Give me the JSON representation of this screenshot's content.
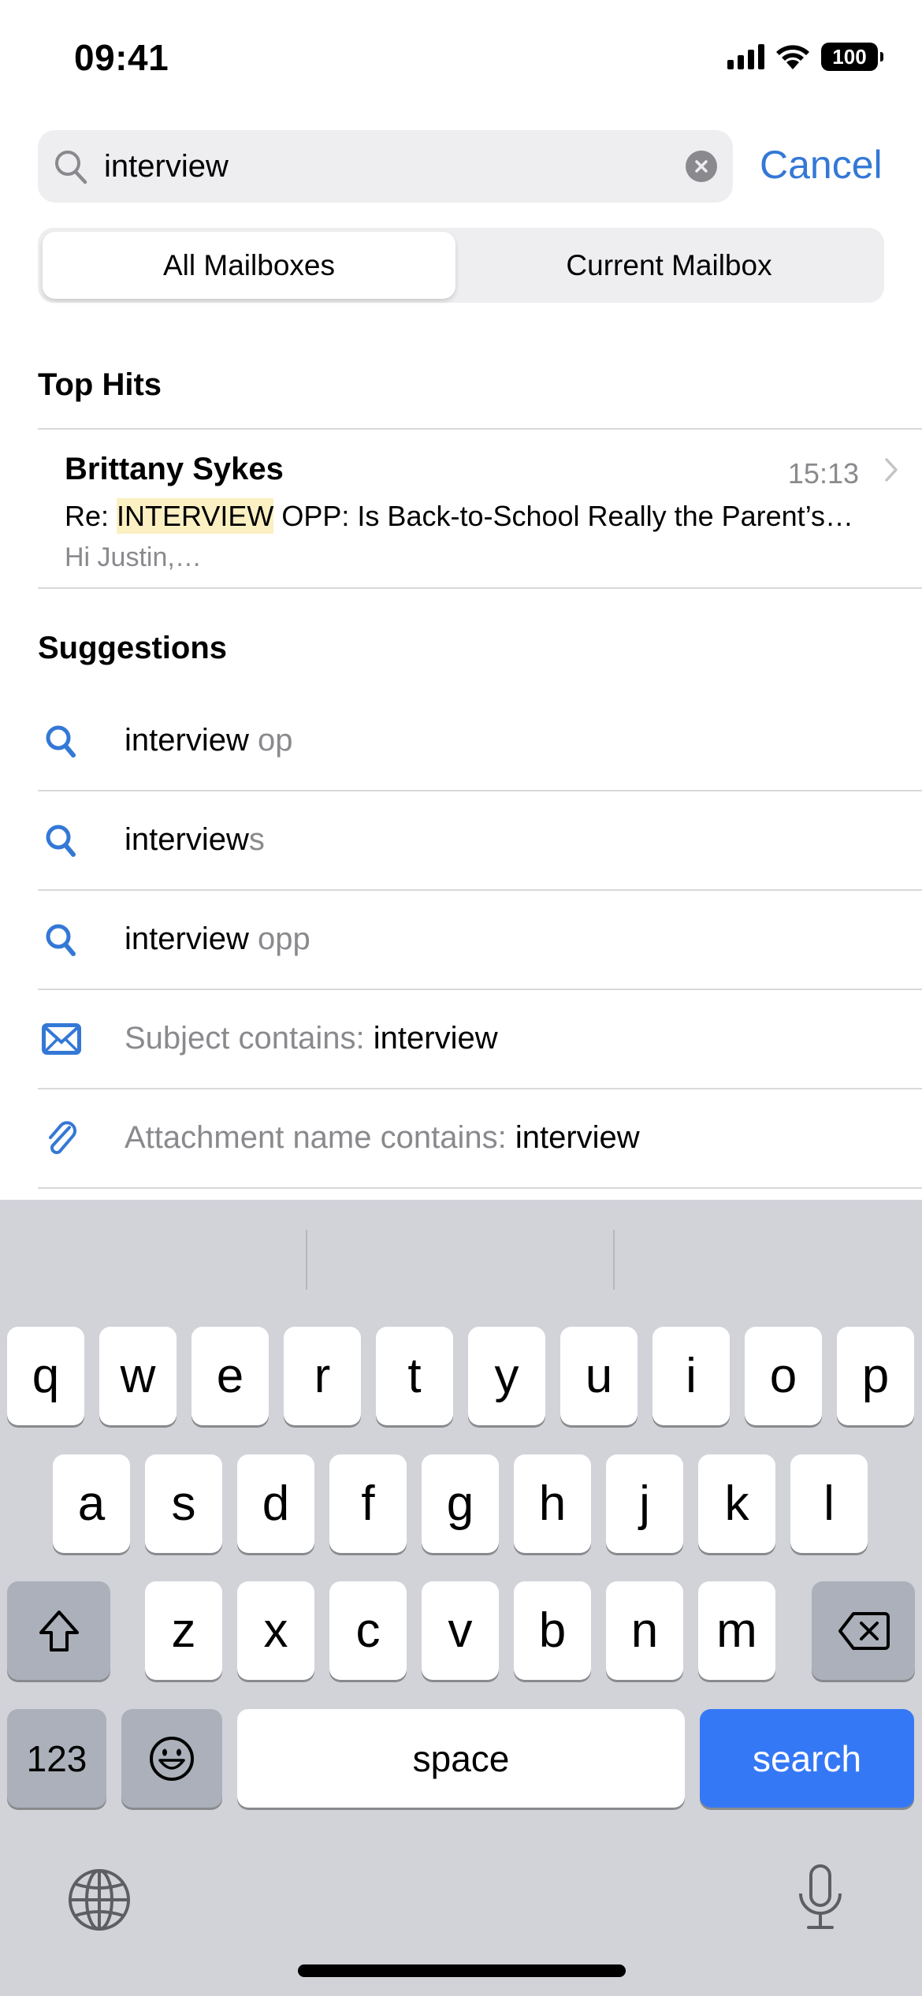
{
  "status_bar": {
    "time": "09:41",
    "battery": "100",
    "icons": [
      "cellular-signal-icon",
      "wifi-icon",
      "battery-icon"
    ]
  },
  "search": {
    "value": "interview",
    "placeholder": "Search",
    "cancel_label": "Cancel",
    "icons": [
      "search-icon",
      "clear-icon"
    ]
  },
  "scope": {
    "options": [
      "All Mailboxes",
      "Current Mailbox"
    ],
    "selected": "All Mailboxes"
  },
  "top_hits": {
    "title": "Top Hits",
    "items": [
      {
        "sender": "Brittany Sykes",
        "time": "15:13",
        "subject_prefix": "Re: ",
        "subject_highlight": "INTERVIEW",
        "subject_rest": " OPP: Is Back-to-School Really the Parent’s…",
        "preview": "Hi Justin,…",
        "highlight_color": "#fbf0c2"
      }
    ]
  },
  "suggestions": {
    "title": "Suggestions",
    "items": [
      {
        "icon": "search-icon",
        "primary": "interview",
        "secondary": " op",
        "order": "primary-first"
      },
      {
        "icon": "search-icon",
        "primary": "interview",
        "secondary": "s",
        "order": "primary-first"
      },
      {
        "icon": "search-icon",
        "primary": "interview",
        "secondary": " opp",
        "order": "primary-first"
      },
      {
        "icon": "envelope-icon",
        "secondary": "Subject contains: ",
        "primary": "interview",
        "order": "secondary-first"
      },
      {
        "icon": "paperclip-icon",
        "secondary": "Attachment name contains: ",
        "primary": "interview",
        "order": "secondary-first"
      }
    ]
  },
  "keyboard": {
    "row1": [
      "q",
      "w",
      "e",
      "r",
      "t",
      "y",
      "u",
      "i",
      "o",
      "p"
    ],
    "row2": [
      "a",
      "s",
      "d",
      "f",
      "g",
      "h",
      "j",
      "k",
      "l"
    ],
    "row3": [
      "z",
      "x",
      "c",
      "v",
      "b",
      "n",
      "m"
    ],
    "numbers_label": "123",
    "space_label": "space",
    "return_label": "search",
    "icons": [
      "shift-icon",
      "delete-icon",
      "emoji-icon",
      "globe-icon",
      "microphone-icon"
    ]
  },
  "colors": {
    "accent": "#3478d6",
    "search_key": "#3578f6",
    "secondary_text": "#8a8a8e",
    "keyboard_bg": "#d1d3d9"
  }
}
